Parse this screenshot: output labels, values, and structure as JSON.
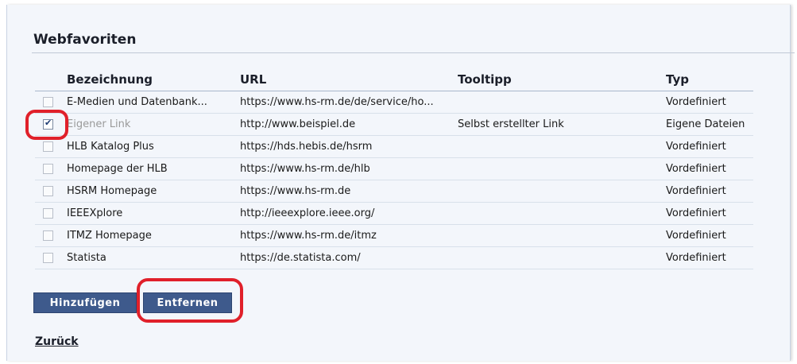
{
  "panel": {
    "title": "Webfavoriten"
  },
  "table": {
    "headers": {
      "name": "Bezeichnung",
      "url": "URL",
      "tooltip": "Tooltipp",
      "type": "Typ"
    },
    "rows": [
      {
        "name": "E-Medien und Datenbank...",
        "url": "https://www.hs-rm.de/de/service/ho...",
        "tooltip": "",
        "type": "Vordefiniert",
        "checked": false
      },
      {
        "name": "Eigener Link",
        "url": "http://www.beispiel.de",
        "tooltip": "Selbst erstellter Link",
        "type": "Eigene Dateien",
        "checked": true
      },
      {
        "name": "HLB Katalog Plus",
        "url": "https://hds.hebis.de/hsrm",
        "tooltip": "",
        "type": "Vordefiniert",
        "checked": false
      },
      {
        "name": "Homepage der HLB",
        "url": "https://www.hs-rm.de/hlb",
        "tooltip": "",
        "type": "Vordefiniert",
        "checked": false
      },
      {
        "name": "HSRM Homepage",
        "url": "https://www.hs-rm.de",
        "tooltip": "",
        "type": "Vordefiniert",
        "checked": false
      },
      {
        "name": "IEEEXplore",
        "url": "http://ieeexplore.ieee.org/",
        "tooltip": "",
        "type": "Vordefiniert",
        "checked": false
      },
      {
        "name": "ITMZ Homepage",
        "url": "https://www.hs-rm.de/itmz",
        "tooltip": "",
        "type": "Vordefiniert",
        "checked": false
      },
      {
        "name": "Statista",
        "url": "https://de.statista.com/",
        "tooltip": "",
        "type": "Vordefiniert",
        "checked": false
      }
    ]
  },
  "actions": {
    "add_label": "Hinzufügen",
    "remove_label": "Entfernen"
  },
  "back_label": "Zurück",
  "colors": {
    "button": "#3e5a8c",
    "highlight": "#e0202a"
  }
}
